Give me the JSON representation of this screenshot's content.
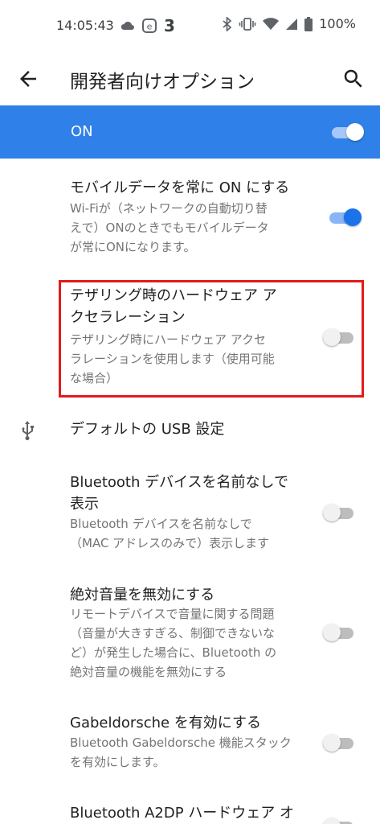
{
  "status_bar": {
    "time": "14:05:43",
    "left_icons": [
      "cloud-icon",
      "e-badge-icon"
    ],
    "notification_count": "3",
    "right_icons": [
      "bluetooth-icon",
      "vibrate-icon",
      "wifi-icon",
      "cellular-signal-icon",
      "battery-icon"
    ],
    "battery": "100%"
  },
  "app_bar": {
    "title": "開発者向けオプション",
    "back_icon": "arrow-back-icon",
    "search_icon": "search-icon"
  },
  "master_switch": {
    "label": "ON",
    "state": true,
    "bar_color": "#2f80e8"
  },
  "settings": [
    {
      "title": "モバイルデータを常に ON にする",
      "summary_lines": [
        "Wi-Fiが（ネットワークの自動切り替",
        "えで）ONのときでもモバイルデータ",
        "が常にONになります。"
      ],
      "toggle": true
    },
    {
      "title_lines": [
        "テザリング時のハードウェア ア",
        "クセラレーション"
      ],
      "summary_lines": [
        "テザリング時にハードウェア アクセ",
        "ラレーションを使用します（使用可能",
        "な場合）"
      ],
      "toggle": false,
      "highlighted": true
    },
    {
      "title": "デフォルトの USB 設定",
      "icon": "usb-icon"
    },
    {
      "title_lines": [
        "Bluetooth デバイスを名前なしで",
        "表示"
      ],
      "summary_lines": [
        "Bluetooth デバイスを名前なしで",
        "（MAC アドレスのみで）表示します"
      ],
      "toggle": false
    },
    {
      "title": "絶対音量を無効にする",
      "summary_lines": [
        "リモートデバイスで音量に関する問題",
        "（音量が大きすぎる、制御できないな",
        "ど）が発生した場合に、Bluetooth の",
        "絶対音量の機能を無効にする"
      ],
      "toggle": false
    },
    {
      "title": "Gabeldorsche を有効にする",
      "summary_lines": [
        "Bluetooth Gabeldorsche 機能スタック",
        "を有効にします。"
      ],
      "toggle": false
    },
    {
      "title": "Bluetooth A2DP ハードウェア オ",
      "toggle": false
    }
  ],
  "colors": {
    "accent": "#1a73e8",
    "highlight_border": "#e21b1b"
  }
}
